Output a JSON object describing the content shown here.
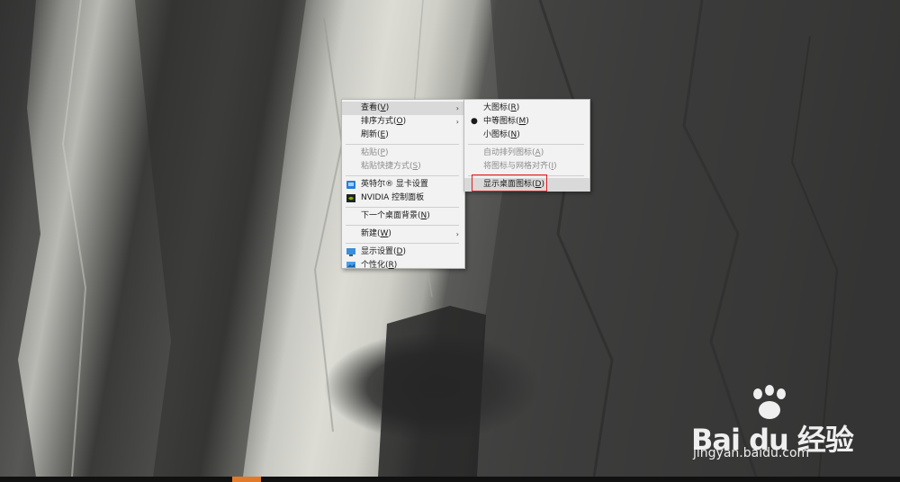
{
  "main_menu": {
    "items": [
      {
        "label": "查看(",
        "key": "V",
        "suffix": ")"
      },
      {
        "label": "排序方式(",
        "key": "O",
        "suffix": ")"
      },
      {
        "label": "刷新(",
        "key": "E",
        "suffix": ")"
      },
      {
        "label": "粘贴(",
        "key": "P",
        "suffix": ")"
      },
      {
        "label": "粘贴快捷方式(",
        "key": "S",
        "suffix": ")"
      },
      {
        "label": "英特尔® 显卡设置"
      },
      {
        "label": "NVIDIA 控制面板"
      },
      {
        "label": "下一个桌面背景(",
        "key": "N",
        "suffix": ")"
      },
      {
        "label": "新建(",
        "key": "W",
        "suffix": ")"
      },
      {
        "label": "显示设置(",
        "key": "D",
        "suffix": ")"
      },
      {
        "label": "个性化(",
        "key": "R",
        "suffix": ")"
      }
    ],
    "submenu_arrow": "›"
  },
  "view_submenu": {
    "items": [
      {
        "label": "大图标(",
        "key": "R",
        "suffix": ")"
      },
      {
        "label": "中等图标(",
        "key": "M",
        "suffix": ")"
      },
      {
        "label": "小图标(",
        "key": "N",
        "suffix": ")"
      },
      {
        "label": "自动排列图标(",
        "key": "A",
        "suffix": ")"
      },
      {
        "label": "将图标与网格对齐(",
        "key": "I",
        "suffix": ")"
      },
      {
        "label": "显示桌面图标(",
        "key": "D",
        "suffix": ")"
      }
    ],
    "selected_bullet": "●"
  },
  "watermark": {
    "brand": "Bai du 经验",
    "url": "jingyan.baidu.com"
  },
  "colors": {
    "menu_bg": "#f2f2f2",
    "highlight": "#d9d9d9",
    "annotation_box": "#e02020",
    "taskbar": "#111111",
    "taskbar_accent": "#e07a2a"
  }
}
